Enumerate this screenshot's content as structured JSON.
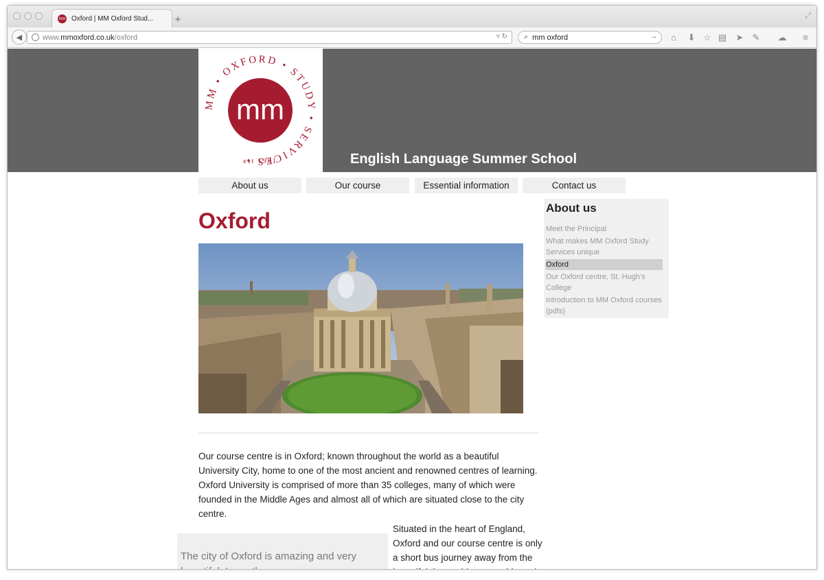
{
  "browser": {
    "tab_title": "Oxford | MM Oxford Stud...",
    "tab_favicon_text": "mm",
    "new_tab_label": "+",
    "url_prefix": "www.",
    "url_host": "mmoxford.co.uk",
    "url_path": "/oxford",
    "search_query": "mm oxford",
    "icons": [
      "back-icon",
      "globe-icon",
      "reload-icon",
      "search-icon",
      "home-icon",
      "download-icon",
      "bookmark-star-icon",
      "reading-list-icon",
      "share-icon",
      "addon-icon",
      "chat-icon",
      "menu-icon"
    ]
  },
  "site": {
    "logo": {
      "monogram": "mm",
      "ring_text": "MM • OXFORD • STUDY • SERVICES •",
      "established": "est 1981",
      "color": "#a51c30"
    },
    "tagline": "English Language Summer School",
    "header_color": "#636363"
  },
  "nav": {
    "items": [
      {
        "label": "About us"
      },
      {
        "label": "Our course"
      },
      {
        "label": "Essential information"
      },
      {
        "label": "Contact us"
      }
    ]
  },
  "main": {
    "title": "Oxford",
    "image_alt": "Aerial view of the Radcliffe Camera, Oxford",
    "intro": "Our course centre is in Oxford; known throughout the world as a beautiful University City, home to one of the most ancient and renowned centres of learning. Oxford University is comprised of more than 35 colleges, many of which were founded in the Middle Ages and almost all of which are situated close to the city centre.",
    "quote": "The city of Oxford is amazing and very beautiful. I saw the",
    "right_text": "Situated in the heart of England, Oxford and our course centre is only a short bus journey away from the beautiful Cotswold countryside and"
  },
  "sidebar": {
    "title": "About us",
    "links": [
      {
        "label": "Meet the Principal",
        "active": false
      },
      {
        "label": "What makes MM Oxford Study Services unique",
        "active": false
      },
      {
        "label": "Oxford",
        "active": true
      },
      {
        "label": "Our Oxford centre, St. Hugh’s College",
        "active": false
      },
      {
        "label": "Introduction to MM Oxford courses (pdfs)",
        "active": false
      }
    ]
  }
}
